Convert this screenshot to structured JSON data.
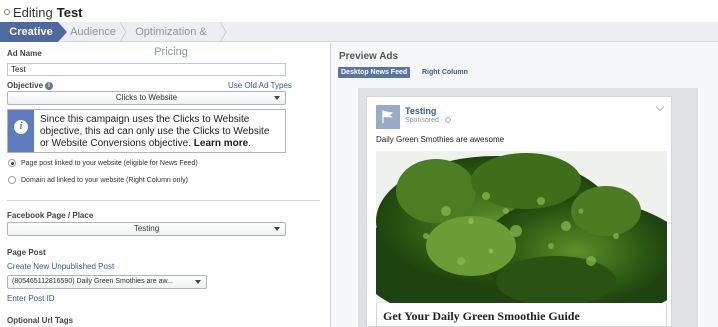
{
  "header": {
    "label": "Editing",
    "name": "Test"
  },
  "steps": [
    {
      "label": "Creative",
      "active": true
    },
    {
      "label": "Audience",
      "active": false
    },
    {
      "label": "Optimization & Pricing",
      "active": false
    }
  ],
  "form": {
    "ad_name_label": "Ad Name",
    "ad_name_value": "Test",
    "objective_label": "Objective",
    "use_old_link": "Use Old Ad Types",
    "objective_value": "Clicks to Website",
    "notice_text": "Since this campaign uses the Clicks to Website objective, this ad can only use the Clicks to Website or Website Conversions objective.",
    "notice_link": "Learn more",
    "radio_page_post": "Page post linked to your website (eligible for News Feed)",
    "radio_domain_ad": "Domain ad linked to your website (Right Column only)",
    "selected_radio": "page_post",
    "page_label": "Facebook Page / Place",
    "page_value": "Testing",
    "page_post_label": "Page Post",
    "create_post_link": "Create New Unpublished Post",
    "post_value": "(805465112816590) Daily Green Smothies are aw...",
    "enter_post_id": "Enter Post ID",
    "url_tags_label": "Optional Url Tags"
  },
  "preview": {
    "title": "Preview Ads",
    "tabs": [
      "Desktop News Feed",
      "Right Column"
    ],
    "active_tab": "Desktop News Feed",
    "page_name": "Testing",
    "sponsored": "Sponsored · ",
    "post_text": "Daily Green Smothies are awesome",
    "cta_title": "Get Your Daily Green Smoothie Guide"
  },
  "colors": {
    "accent": "#4e69a2",
    "link": "#3b5998",
    "notice_side": "#5d7bbd"
  }
}
